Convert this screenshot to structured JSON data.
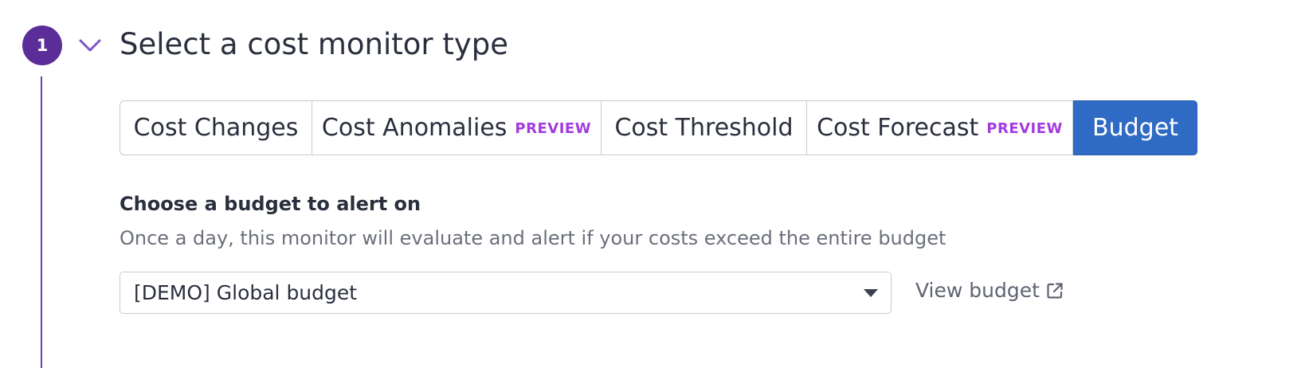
{
  "step": {
    "number": "1",
    "title": "Select a cost monitor type",
    "icon": "chevron-down-icon",
    "accent_color": "#5b2d99"
  },
  "monitor_types": {
    "options": [
      {
        "label": "Cost Changes",
        "badge": "",
        "active": false
      },
      {
        "label": "Cost Anomalies",
        "badge": "PREVIEW",
        "active": false
      },
      {
        "label": "Cost Threshold",
        "badge": "",
        "active": false
      },
      {
        "label": "Cost Forecast",
        "badge": "PREVIEW",
        "active": false
      },
      {
        "label": "Budget",
        "badge": "",
        "active": true
      }
    ],
    "active_color": "#2f6bc4",
    "badge_color": "#a33be0"
  },
  "budget": {
    "label": "Choose a budget to alert on",
    "help": "Once a day, this monitor will evaluate and alert if your costs exceed the entire budget",
    "selected": "[DEMO] Global budget",
    "view_link": "View budget",
    "view_link_icon": "external-link-icon"
  }
}
